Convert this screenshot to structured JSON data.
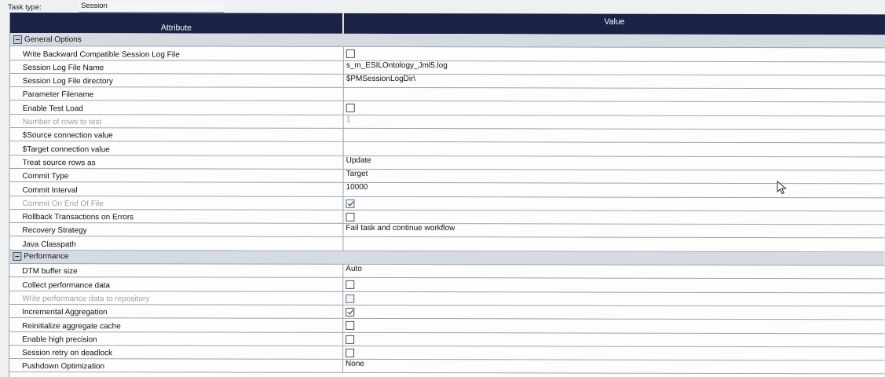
{
  "task": {
    "label": "Task type:",
    "value": "Session"
  },
  "grid": {
    "header_attribute": "Attribute",
    "header_value": "Value"
  },
  "groups": [
    {
      "label": "General Options",
      "rows": [
        {
          "attr": "Write Backward Compatible Session Log File",
          "type": "checkbox",
          "checked": false,
          "disabled": false
        },
        {
          "attr": "Session Log File Name",
          "type": "text",
          "value": "s_m_ESILOntology_Jml5.log",
          "disabled": false
        },
        {
          "attr": "Session Log File directory",
          "type": "text",
          "value": "$PMSessionLogDir\\",
          "disabled": false
        },
        {
          "attr": "Parameter Filename",
          "type": "text",
          "value": "",
          "disabled": false
        },
        {
          "attr": "Enable Test Load",
          "type": "checkbox",
          "checked": false,
          "disabled": false
        },
        {
          "attr": "Number of rows to test",
          "type": "text",
          "value": "1",
          "disabled": true
        },
        {
          "attr": "$Source connection value",
          "type": "text",
          "value": "",
          "disabled": false
        },
        {
          "attr": "$Target connection value",
          "type": "text",
          "value": "",
          "disabled": false
        },
        {
          "attr": "Treat source rows as",
          "type": "text",
          "value": "Update",
          "disabled": false
        },
        {
          "attr": "Commit Type",
          "type": "text",
          "value": "Target",
          "disabled": false
        },
        {
          "attr": "Commit Interval",
          "type": "text",
          "value": "10000",
          "disabled": false
        },
        {
          "attr": "Commit On End Of File",
          "type": "checkbox",
          "checked": true,
          "disabled": true
        },
        {
          "attr": "Rollback Transactions on Errors",
          "type": "checkbox",
          "checked": false,
          "disabled": false
        },
        {
          "attr": "Recovery Strategy",
          "type": "text",
          "value": "Fail task and continue workflow",
          "disabled": false
        },
        {
          "attr": "Java Classpath",
          "type": "text",
          "value": "",
          "disabled": false
        }
      ]
    },
    {
      "label": "Performance",
      "rows": [
        {
          "attr": "DTM buffer size",
          "type": "text",
          "value": "Auto",
          "disabled": false
        },
        {
          "attr": "Collect performance data",
          "type": "checkbox",
          "checked": false,
          "disabled": false
        },
        {
          "attr": "Write performance data to repository",
          "type": "checkbox",
          "checked": false,
          "disabled": true
        },
        {
          "attr": "Incremental Aggregation",
          "type": "checkbox",
          "checked": true,
          "disabled": false
        },
        {
          "attr": "Reinitialize aggregate cache",
          "type": "checkbox",
          "checked": false,
          "disabled": false
        },
        {
          "attr": "Enable high precision",
          "type": "checkbox",
          "checked": false,
          "disabled": false
        },
        {
          "attr": "Session retry on deadlock",
          "type": "checkbox",
          "checked": false,
          "disabled": false
        },
        {
          "attr": "Pushdown Optimization",
          "type": "text",
          "value": "None",
          "disabled": false
        }
      ]
    }
  ]
}
